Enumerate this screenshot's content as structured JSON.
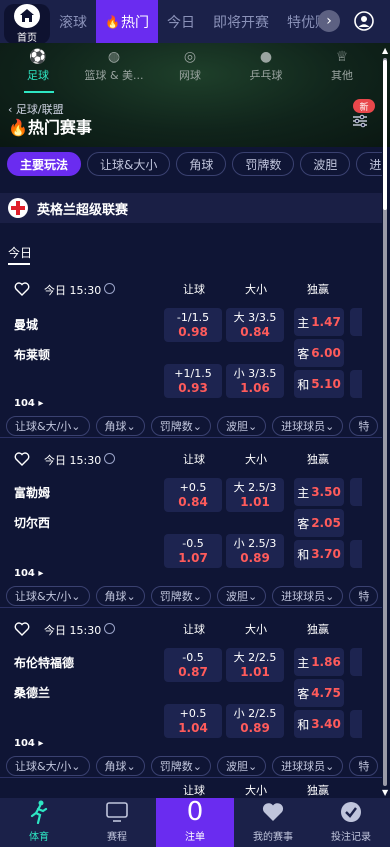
{
  "nav": {
    "home_label": "首页",
    "tabs": [
      {
        "label": "滚球",
        "active": false
      },
      {
        "label": "热门",
        "active": true
      },
      {
        "label": "今日",
        "active": false
      },
      {
        "label": "即将开赛",
        "active": false
      },
      {
        "label": "特优赔",
        "active": false
      }
    ]
  },
  "sports": [
    {
      "label": "足球",
      "icon": "soccer-icon",
      "active": true
    },
    {
      "label": "篮球 & 美...",
      "icon": "basketball-icon",
      "active": false
    },
    {
      "label": "网球",
      "icon": "tennis-icon",
      "active": false
    },
    {
      "label": "乒乓球",
      "icon": "table-tennis-icon",
      "active": false
    },
    {
      "label": "其他",
      "icon": "trophy-icon",
      "active": false
    }
  ],
  "breadcrumb": "足球/联盟",
  "page_title": "热门赛事",
  "new_badge": "新",
  "filters": [
    {
      "label": "主要玩法",
      "active": true
    },
    {
      "label": "让球&大小",
      "active": false
    },
    {
      "label": "角球",
      "active": false
    },
    {
      "label": "罚牌数",
      "active": false
    },
    {
      "label": "波胆",
      "active": false
    },
    {
      "label": "进",
      "active": false
    }
  ],
  "league": {
    "name": "英格兰超级联赛"
  },
  "day_label": "今日",
  "headers": {
    "handicap": "让球",
    "ou": "大小",
    "win": "独赢",
    "cut": "让"
  },
  "matches": [
    {
      "time": "今日 15:30",
      "home": "曼城",
      "away": "布莱顿",
      "more": "104",
      "hcp_home": {
        "line": "-1/1.5",
        "odds": "0.98"
      },
      "hcp_away": {
        "line": "+1/1.5",
        "odds": "0.93"
      },
      "ou_over": {
        "line": "大 3/3.5",
        "odds": "0.84"
      },
      "ou_under": {
        "line": "小 3/3.5",
        "odds": "1.06"
      },
      "win_home": {
        "label": "主",
        "odds": "1.47"
      },
      "win_away": {
        "label": "客",
        "odds": "6.00"
      },
      "win_draw": {
        "label": "和",
        "odds": "5.10"
      }
    },
    {
      "time": "今日 15:30",
      "home": "富勒姆",
      "away": "切尔西",
      "more": "104",
      "hcp_home": {
        "line": "+0.5",
        "odds": "0.84"
      },
      "hcp_away": {
        "line": "-0.5",
        "odds": "1.07"
      },
      "ou_over": {
        "line": "大 2.5/3",
        "odds": "1.01"
      },
      "ou_under": {
        "line": "小 2.5/3",
        "odds": "0.89"
      },
      "win_home": {
        "label": "主",
        "odds": "3.50"
      },
      "win_away": {
        "label": "客",
        "odds": "2.05"
      },
      "win_draw": {
        "label": "和",
        "odds": "3.70"
      }
    },
    {
      "time": "今日 15:30",
      "home": "布伦特福德",
      "away": "桑德兰",
      "more": "104",
      "hcp_home": {
        "line": "-0.5",
        "odds": "0.87"
      },
      "hcp_away": {
        "line": "+0.5",
        "odds": "1.04"
      },
      "ou_over": {
        "line": "大 2/2.5",
        "odds": "1.01"
      },
      "ou_under": {
        "line": "小 2/2.5",
        "odds": "0.89"
      },
      "win_home": {
        "label": "主",
        "odds": "1.86"
      },
      "win_away": {
        "label": "客",
        "odds": "4.75"
      },
      "win_draw": {
        "label": "和",
        "odds": "3.40"
      }
    }
  ],
  "sub_filters": [
    "让球&大/小",
    "角球",
    "罚牌数",
    "波胆",
    "进球球员",
    "特"
  ],
  "bottom": [
    {
      "label": "体育",
      "icon": "runner-icon",
      "active": true
    },
    {
      "label": "赛程",
      "icon": "monitor-icon",
      "active": false
    },
    {
      "label": "注单",
      "count": "0",
      "active": false
    },
    {
      "label": "我的赛事",
      "icon": "heart-icon",
      "active": false
    },
    {
      "label": "投注记录",
      "icon": "check-icon",
      "active": false
    }
  ],
  "colors": {
    "accent": "#6a2cf0",
    "teal": "#2ee6c3",
    "odds": "#ff5b5b",
    "bg": "#0f1535"
  }
}
